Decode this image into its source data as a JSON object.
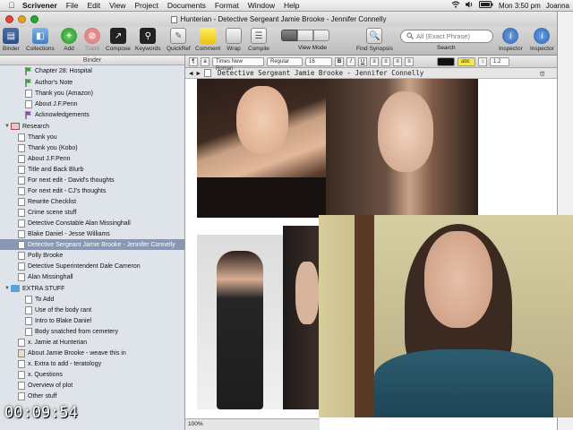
{
  "menubar": {
    "app": "Scrivener",
    "items": [
      "File",
      "Edit",
      "View",
      "Project",
      "Documents",
      "Format",
      "Window",
      "Help"
    ],
    "clock": "Mon 3:50 pm",
    "user": "Joanna"
  },
  "window": {
    "title": "Hunterian - Detective Sergeant Jamie Brooke - Jennifer Connelly"
  },
  "toolbar": {
    "binder": "Binder",
    "collections": "Collections",
    "add": "Add",
    "trash": "Trash",
    "compose": "Compose",
    "keywords": "Keywords",
    "quickref": "QuickRef",
    "comment": "Comment",
    "wrap": "Wrap",
    "compile": "Compile",
    "view_mode": "View Mode",
    "find_synopsis": "Find Synopsis",
    "search_placeholder": "All (Exact Phrase)",
    "search": "Search",
    "inspector": "Inspector",
    "inspector2": "Inspector"
  },
  "binder": {
    "header": "Binder",
    "items": [
      {
        "label": "Chapter 28: Hospital",
        "icon": "flag-green-icon"
      },
      {
        "label": "Author's Note",
        "icon": "flag-green-icon"
      },
      {
        "label": "Thank you (Amazon)",
        "icon": "document-icon"
      },
      {
        "label": "About J.F.Penn",
        "icon": "document-icon"
      },
      {
        "label": "Acknowledgements",
        "icon": "flag-purple-icon"
      },
      {
        "label": "Research",
        "icon": "research-folder-icon"
      },
      {
        "label": "Thank you",
        "icon": "document-icon"
      },
      {
        "label": "Thank you (Kobo)",
        "icon": "document-icon"
      },
      {
        "label": "About J.F.Penn",
        "icon": "document-icon"
      },
      {
        "label": "Title and Back Blurb",
        "icon": "document-icon"
      },
      {
        "label": "For next edit - David's thoughts",
        "icon": "document-icon"
      },
      {
        "label": "For next edit - CJ's thoughts",
        "icon": "document-icon"
      },
      {
        "label": "Rewrite Checklist",
        "icon": "document-icon"
      },
      {
        "label": "Crime scene stuff",
        "icon": "document-icon"
      },
      {
        "label": "Detective Constable Alan Missinghall",
        "icon": "document-icon"
      },
      {
        "label": "Blake Daniel - Jesse Williams",
        "icon": "document-icon"
      },
      {
        "label": "Detective Sergeant Jamie Brooke - Jennifer Connelly",
        "icon": "document-icon"
      },
      {
        "label": "Polly Brooke",
        "icon": "document-icon"
      },
      {
        "label": "Detective Superintendent Dale Cameron",
        "icon": "document-icon"
      },
      {
        "label": "Alan Missinghall",
        "icon": "document-icon"
      },
      {
        "label": "EXTRA STUFF",
        "icon": "folder-icon"
      },
      {
        "label": "To Add",
        "icon": "document-icon"
      },
      {
        "label": "Use of the body rant",
        "icon": "document-icon"
      },
      {
        "label": "Intro to Blake Daniel",
        "icon": "document-icon"
      },
      {
        "label": "Body snatched from cemetery",
        "icon": "document-icon"
      },
      {
        "label": "x. Jamie at Hunterian",
        "icon": "document-icon"
      },
      {
        "label": "About Jamie Brooke - weave this in",
        "icon": "document-icon"
      },
      {
        "label": "x. Extra to add - teratology",
        "icon": "document-icon"
      },
      {
        "label": "x. Questions",
        "icon": "document-icon"
      },
      {
        "label": "Overview of plot",
        "icon": "document-icon"
      },
      {
        "label": "Other stuff",
        "icon": "document-icon"
      }
    ]
  },
  "format": {
    "font": "Times New Roman",
    "style": "Regular",
    "size": "16",
    "bold": "B",
    "italic": "I",
    "underline": "U",
    "highlight": "abc",
    "spacing": "1.2"
  },
  "editor": {
    "doc_title": "Detective Sergeant Jamie Brooke - Jennifer Connelly",
    "zoom": "100%"
  },
  "timer": "00:09:54"
}
